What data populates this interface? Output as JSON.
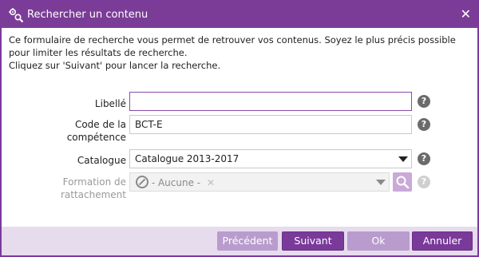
{
  "dialog": {
    "title": "Rechercher un contenu",
    "close_icon": "close-icon"
  },
  "intro": {
    "line1": "Ce formulaire de recherche vous permet de retrouver vos contenus. Soyez le plus précis possible pour limiter les résultats de recherche.",
    "line2": "Cliquez sur 'Suivant' pour lancer la recherche."
  },
  "form": {
    "libelle": {
      "label": "Libellé",
      "value": ""
    },
    "code": {
      "label_line1": "Code de la",
      "label_line2": "compétence",
      "value": "BCT-E"
    },
    "catalogue": {
      "label": "Catalogue",
      "selected": "Catalogue 2013-2017"
    },
    "formation": {
      "label_line1": "Formation de",
      "label_line2": "rattachement",
      "selected": "- Aucune -"
    },
    "help_glyph": "?"
  },
  "buttons": {
    "previous": "Précédent",
    "next": "Suivant",
    "ok": "Ok",
    "cancel": "Annuler"
  },
  "colors": {
    "accent": "#7b3c98",
    "footer": "#e7dbee"
  }
}
